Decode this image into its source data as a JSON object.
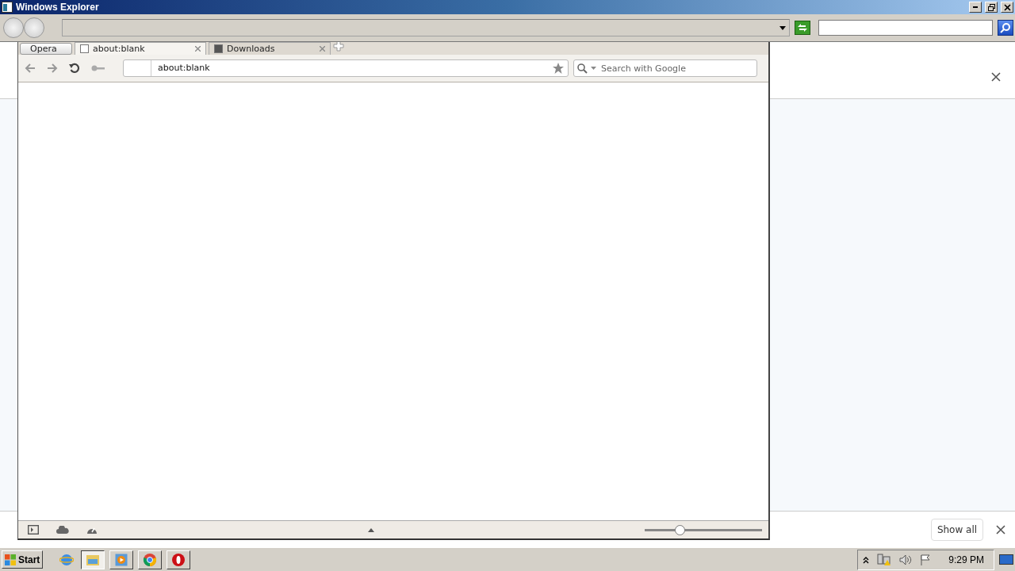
{
  "explorer": {
    "title": "Windows Explorer"
  },
  "opera": {
    "menu_label": "Opera",
    "tabs": [
      {
        "label": "about:blank",
        "selected": true
      },
      {
        "label": "Downloads",
        "selected": false
      }
    ],
    "address": "about:blank",
    "search": {
      "placeholder": "Search with Google"
    },
    "zoom": {
      "level": 0.28
    }
  },
  "chrome": {
    "download_bar": {
      "button": "Show all"
    }
  },
  "taskbar": {
    "start": "Start",
    "apps": [
      {
        "kind": "ie",
        "selected": false
      },
      {
        "kind": "folder",
        "selected": true
      },
      {
        "kind": "media",
        "selected": false
      },
      {
        "kind": "chrome",
        "selected": false
      },
      {
        "kind": "opera",
        "selected": false
      }
    ],
    "clock": "9:29 PM"
  }
}
